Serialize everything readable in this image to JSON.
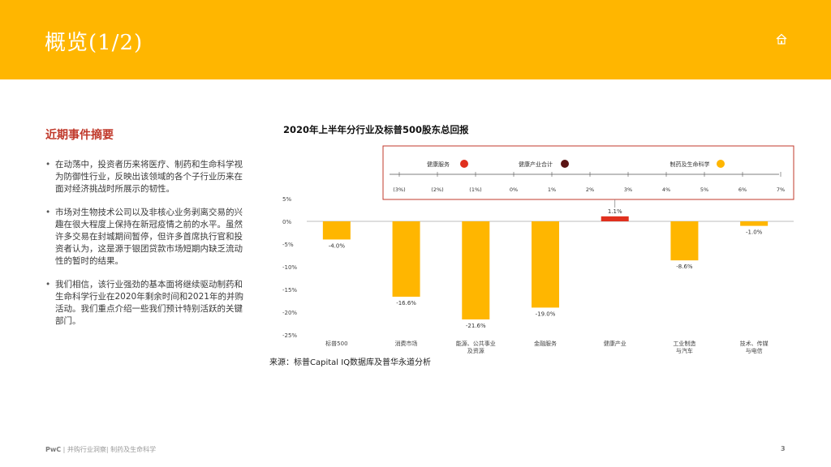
{
  "header": {
    "title": "概览(1/2)",
    "home_icon": "home-icon"
  },
  "section_title": "近期事件摘要",
  "bullets": [
    "在动荡中，投资者历来将医疗、制药和生命科学视为防御性行业，反映出该领域的各个子行业历来在面对经济挑战时所展示的韧性。",
    "市场对生物技术公司以及非核心业务剥离交易的兴趣在很大程度上保持在新冠疫情之前的水平。虽然许多交易在封城期间暂停，但许多首席执行官和投资者认为，这是源于银团贷款市场短期内缺乏流动性的暂时的结果。",
    "我们相信，该行业强劲的基本面将继续驱动制药和生命科学行业在2020年剩余时间和2021年的并购活动。我们重点介绍一些我们预计特别活跃的关键部门。"
  ],
  "chart_title": "2020年上半年分行业及标普500股东总回报",
  "chart_data": {
    "type": "bar",
    "categories": [
      "标普500",
      "消费市场",
      "能源、公共事业及资源",
      "金融服务",
      "健康产业",
      "工业制造与汽车",
      "技术、传媒与电信"
    ],
    "values": [
      -4.0,
      -16.6,
      -21.6,
      -19.0,
      1.1,
      -8.6,
      -1.0
    ],
    "value_labels": [
      "-4.0%",
      "-16.6%",
      "-21.6%",
      "-19.0%",
      "1.1%",
      "-8.6%",
      "-1.0%"
    ],
    "yticks": [
      "5%",
      "0%",
      "-5%",
      "-10%",
      "-15%",
      "-20%",
      "-25%"
    ],
    "ylim": [
      -25,
      5
    ],
    "bar_color": "#ffb600",
    "highlight_color": "#e0301e",
    "highlight_index": 4,
    "inset": {
      "legend": [
        {
          "label": "健康服务",
          "color": "#e0301e"
        },
        {
          "label": "健康产业合计",
          "color": "#5a1414"
        },
        {
          "label": "制药及生命科学",
          "color": "#ffb600"
        }
      ],
      "axis_labels": [
        "(3%)",
        "(2%)",
        "(1%)",
        "0%",
        "1%",
        "2%",
        "3%",
        "4%",
        "5%",
        "6%",
        "7%"
      ],
      "border_color": "#c0392b"
    }
  },
  "source": "来源：标普Capital IQ数据库及普华永道分析",
  "footer": {
    "brand": "PwC",
    "text": " | 并购行业洞察| 制药及生命科学"
  },
  "page_number": "3"
}
